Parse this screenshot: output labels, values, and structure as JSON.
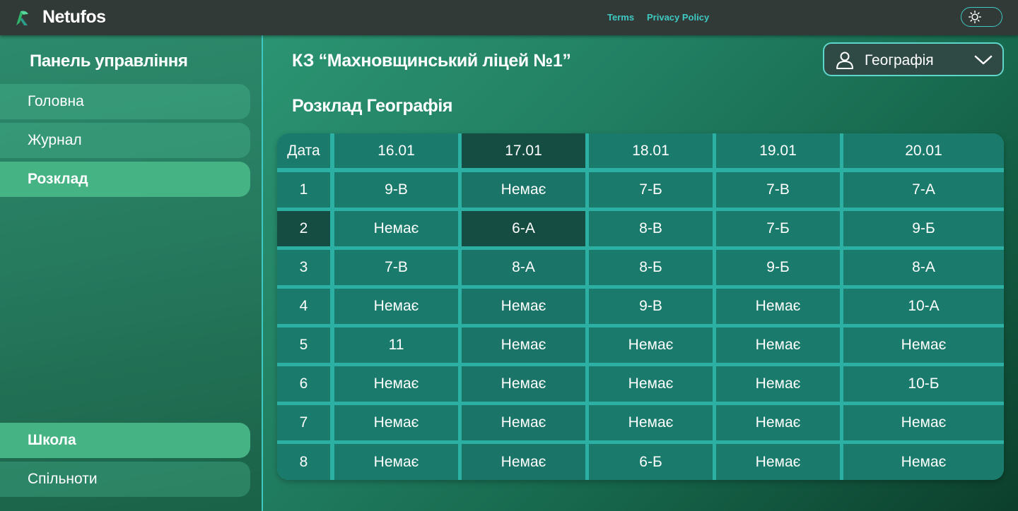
{
  "header": {
    "app_name": "Netufos",
    "links": [
      {
        "label": "Terms"
      },
      {
        "label": "Privacy Policy"
      }
    ],
    "theme_icon": "sun-icon"
  },
  "sidebar": {
    "title": "Панель управління",
    "items": [
      {
        "label": "Головна",
        "active": false
      },
      {
        "label": "Журнал",
        "active": false
      },
      {
        "label": "Розклад",
        "active": true
      }
    ],
    "bottom_items": [
      {
        "label": "Школа",
        "active": true
      },
      {
        "label": "Спільноти",
        "active": false
      }
    ]
  },
  "main": {
    "school_name": "КЗ “Махновщинський ліцей №1”",
    "schedule_title": "Розклад Географія",
    "subject_select": {
      "value": "Географія",
      "icon": "user-icon"
    },
    "table": {
      "corner": "Дата",
      "dates": [
        "16.01",
        "17.01",
        "18.01",
        "19.01",
        "20.01"
      ],
      "rows": [
        {
          "num": "1",
          "cells": [
            "9-В",
            "Немає",
            "7-Б",
            "7-В",
            "7-А"
          ]
        },
        {
          "num": "2",
          "cells": [
            "Немає",
            "6-А",
            "8-В",
            "7-Б",
            "9-Б"
          ]
        },
        {
          "num": "3",
          "cells": [
            "7-В",
            "8-А",
            "8-Б",
            "9-Б",
            "8-А"
          ]
        },
        {
          "num": "4",
          "cells": [
            "Немає",
            "Немає",
            "9-В",
            "Немає",
            "10-А"
          ]
        },
        {
          "num": "5",
          "cells": [
            "11",
            "Немає",
            "Немає",
            "Немає",
            "Немає"
          ]
        },
        {
          "num": "6",
          "cells": [
            "Немає",
            "Немає",
            "Немає",
            "Немає",
            "10-Б"
          ]
        },
        {
          "num": "7",
          "cells": [
            "Немає",
            "Немає",
            "Немає",
            "Немає",
            "Немає"
          ]
        },
        {
          "num": "8",
          "cells": [
            "Немає",
            "Немає",
            "6-Б",
            "Немає",
            "Немає"
          ]
        }
      ],
      "highlight_date": "17.01",
      "highlight_row": "2"
    }
  },
  "colors": {
    "accent": "#3ec9c3",
    "topbar": "#323a37",
    "nav_active": "#45b383",
    "cell": "#1a7b6c",
    "cell_highlight": "#164d43"
  }
}
